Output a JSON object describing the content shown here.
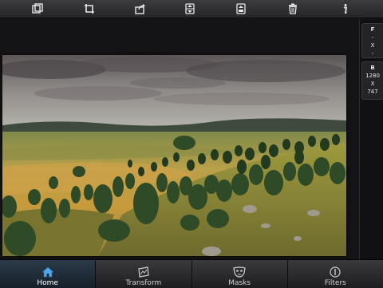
{
  "toolbar": {
    "buttons": [
      {
        "icon": "duplicate-icon"
      },
      {
        "icon": "crop-icon"
      },
      {
        "icon": "share-icon"
      },
      {
        "icon": "flip-vertical-icon"
      },
      {
        "icon": "flip-horizontal-icon"
      },
      {
        "icon": "trash-icon"
      },
      {
        "icon": "info-icon"
      }
    ]
  },
  "side_panel": {
    "format": {
      "heading": "F",
      "line1": "-",
      "line2": "X",
      "line3": "-"
    },
    "size": {
      "heading": "B",
      "width": "1280",
      "x": "X",
      "height": "747"
    }
  },
  "tabs": [
    {
      "label": "Home",
      "icon": "home-icon",
      "active": true
    },
    {
      "label": "Transform",
      "icon": "transform-icon",
      "active": false
    },
    {
      "label": "Masks",
      "icon": "mask-icon",
      "active": false
    },
    {
      "label": "Filters",
      "icon": "filters-icon",
      "active": false
    }
  ],
  "colors": {
    "accent": "#4ea7e8",
    "toolbar": "#2f2f31",
    "background": "#1b1b1d"
  }
}
